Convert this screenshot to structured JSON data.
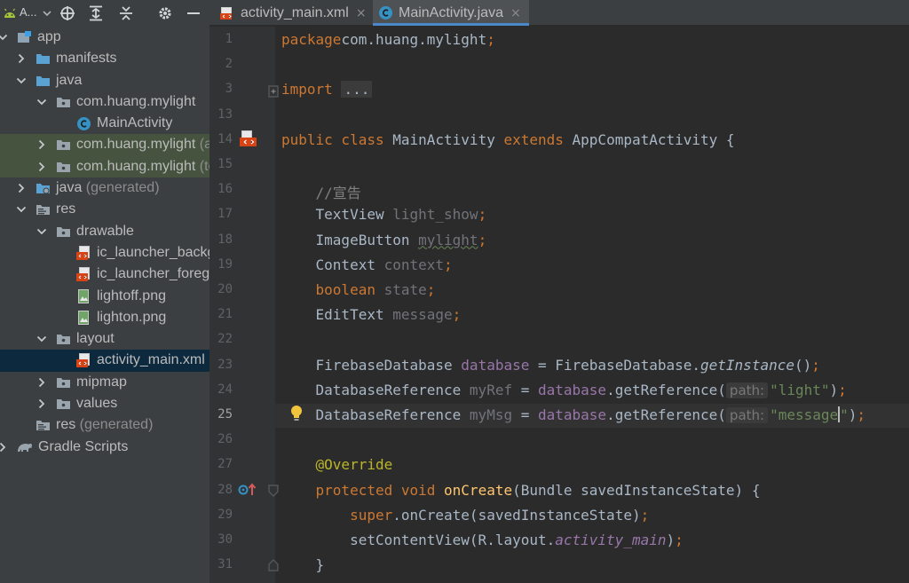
{
  "project_panel": {
    "title": "A..."
  },
  "tree": [
    {
      "label": "app",
      "depth": 0,
      "arrow": "down",
      "icon": "app-module-icon"
    },
    {
      "label": "manifests",
      "depth": 1,
      "arrow": "right",
      "icon": "folder-icon"
    },
    {
      "label": "java",
      "depth": 1,
      "arrow": "down",
      "icon": "folder-icon"
    },
    {
      "label": "com.huang.mylight",
      "depth": 2,
      "arrow": "down",
      "icon": "package-icon"
    },
    {
      "label": "MainActivity",
      "depth": 3,
      "arrow": "",
      "icon": "java-class-icon"
    },
    {
      "label": "com.huang.mylight",
      "depth": 2,
      "arrow": "right",
      "icon": "package-icon",
      "suffix": "(androidTest)"
    },
    {
      "label": "com.huang.mylight",
      "depth": 2,
      "arrow": "right",
      "icon": "package-icon",
      "suffix": "(test)"
    },
    {
      "label": "java",
      "depth": 1,
      "arrow": "right",
      "icon": "generated-folder-icon",
      "gen": "(generated)"
    },
    {
      "label": "res",
      "depth": 1,
      "arrow": "down",
      "icon": "res-folder-icon"
    },
    {
      "label": "drawable",
      "depth": 2,
      "arrow": "down",
      "icon": "package-icon"
    },
    {
      "label": "ic_launcher_background.xml",
      "depth": 3,
      "arrow": "",
      "icon": "xml-file-icon"
    },
    {
      "label": "ic_launcher_foreground.xml",
      "depth": 3,
      "arrow": "",
      "icon": "xml-file-icon"
    },
    {
      "label": "lightoff.png",
      "depth": 3,
      "arrow": "",
      "icon": "image-file-icon"
    },
    {
      "label": "lighton.png",
      "depth": 3,
      "arrow": "",
      "icon": "image-file-icon"
    },
    {
      "label": "layout",
      "depth": 2,
      "arrow": "down",
      "icon": "package-icon"
    },
    {
      "label": "activity_main.xml",
      "depth": 3,
      "arrow": "",
      "icon": "xml-file-icon"
    },
    {
      "label": "mipmap",
      "depth": 2,
      "arrow": "right",
      "icon": "package-icon"
    },
    {
      "label": "values",
      "depth": 2,
      "arrow": "right",
      "icon": "package-icon"
    },
    {
      "label": "res",
      "depth": 1,
      "arrow": "",
      "icon": "res-folder-icon",
      "gen": "(generated)"
    },
    {
      "label": "Gradle Scripts",
      "depth": 0,
      "arrow": "right",
      "icon": "gradle-icon"
    }
  ],
  "tabs": [
    {
      "label": "activity_main.xml",
      "close": "×",
      "active": false
    },
    {
      "label": "MainActivity.java",
      "close": "×",
      "active": true
    }
  ],
  "code_lines": [
    {
      "num": "1",
      "tokens": [
        [
          "kw",
          "package"
        ],
        [
          "",
          "com.huang.mylight"
        ],
        [
          "kw",
          ";"
        ]
      ]
    },
    {
      "num": "2",
      "tokens": []
    },
    {
      "num": "3",
      "tokens": [
        [
          "kw",
          "import "
        ],
        [
          "fold",
          "..."
        ]
      ]
    },
    {
      "num": "13",
      "tokens": []
    },
    {
      "num": "14",
      "tokens": [
        [
          "kw",
          "public class "
        ],
        [
          "",
          "MainActivity "
        ],
        [
          "kw",
          "extends "
        ],
        [
          "",
          "AppCompatActivity {"
        ]
      ]
    },
    {
      "num": "15",
      "tokens": []
    },
    {
      "num": "16",
      "tokens": [
        [
          "",
          "    "
        ],
        [
          "comment",
          "//宣告"
        ]
      ]
    },
    {
      "num": "17",
      "tokens": [
        [
          "",
          "    TextView "
        ],
        [
          "unused",
          "light_show"
        ],
        [
          "kw",
          ";"
        ]
      ]
    },
    {
      "num": "18",
      "tokens": [
        [
          "",
          "    ImageButton "
        ],
        [
          "unusedsq",
          "mylight"
        ],
        [
          "kw",
          ";"
        ]
      ]
    },
    {
      "num": "19",
      "tokens": [
        [
          "",
          "    Context "
        ],
        [
          "unused",
          "context"
        ],
        [
          "kw",
          ";"
        ]
      ]
    },
    {
      "num": "20",
      "tokens": [
        [
          "",
          "    "
        ],
        [
          "kw",
          "boolean "
        ],
        [
          "unused",
          "state"
        ],
        [
          "kw",
          ";"
        ]
      ]
    },
    {
      "num": "21",
      "tokens": [
        [
          "",
          "    EditText "
        ],
        [
          "unused",
          "message"
        ],
        [
          "kw",
          ";"
        ]
      ]
    },
    {
      "num": "22",
      "tokens": []
    },
    {
      "num": "23",
      "tokens": [
        [
          "",
          "    FirebaseDatabase "
        ],
        [
          "field",
          "database"
        ],
        [
          "",
          " = FirebaseDatabase."
        ],
        [
          "italic",
          "getInstance"
        ],
        [
          "",
          "()"
        ],
        [
          "kw",
          ";"
        ]
      ]
    },
    {
      "num": "24",
      "tokens": [
        [
          "",
          "    DatabaseReference "
        ],
        [
          "unused",
          "myRef"
        ],
        [
          "",
          " = "
        ],
        [
          "field",
          "database"
        ],
        [
          "",
          ".getReference("
        ],
        [
          "hint",
          "path:"
        ],
        [
          "str",
          "\"light\""
        ],
        [
          "",
          ")"
        ],
        [
          "kw",
          ";"
        ]
      ]
    },
    {
      "num": "25",
      "tokens": [
        [
          "",
          "    DatabaseReference "
        ],
        [
          "unused",
          "myMsg"
        ],
        [
          "",
          " = "
        ],
        [
          "field",
          "database"
        ],
        [
          "",
          ".getReference("
        ],
        [
          "hint",
          "path:"
        ],
        [
          "str",
          "\"message"
        ],
        [
          "caret",
          ""
        ],
        [
          "str",
          "\""
        ],
        [
          "",
          ")"
        ],
        [
          "kw",
          ";"
        ]
      ]
    },
    {
      "num": "26",
      "tokens": []
    },
    {
      "num": "27",
      "tokens": [
        [
          "",
          "    "
        ],
        [
          "ann",
          "@Override"
        ]
      ]
    },
    {
      "num": "28",
      "tokens": [
        [
          "",
          "    "
        ],
        [
          "kw",
          "protected void "
        ],
        [
          "method",
          "onCreate"
        ],
        [
          "",
          "(Bundle savedInstanceState) {"
        ]
      ]
    },
    {
      "num": "29",
      "tokens": [
        [
          "",
          "        "
        ],
        [
          "kw",
          "super"
        ],
        [
          "",
          ".onCreate(savedInstanceState)"
        ],
        [
          "kw",
          ";"
        ]
      ]
    },
    {
      "num": "30",
      "tokens": [
        [
          "",
          "        setContentView(R.layout."
        ],
        [
          "italicf",
          "activity_main"
        ],
        [
          "",
          ")"
        ],
        [
          "kw",
          ";"
        ]
      ]
    },
    {
      "num": "31",
      "tokens": [
        [
          "",
          "    }"
        ]
      ]
    }
  ],
  "colors": {
    "background": "#2b2b2b",
    "keyword": "#cc7832",
    "string": "#6a8759",
    "field": "#9876aa",
    "annotation": "#bbb529",
    "selection": "#0d293e",
    "accent": "#4a88c7"
  }
}
